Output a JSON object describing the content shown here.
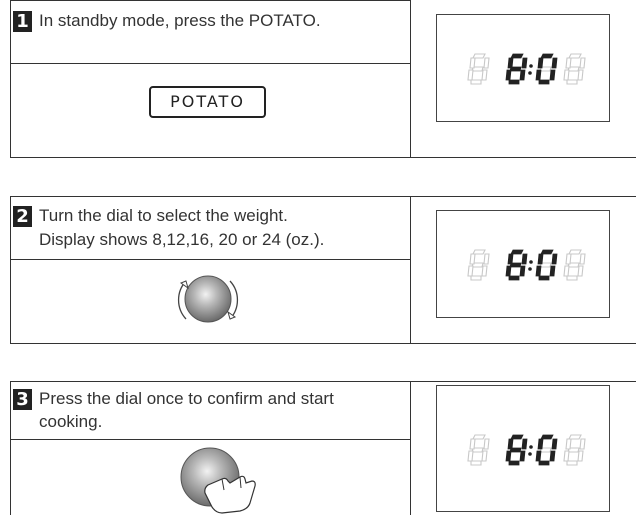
{
  "steps": [
    {
      "number": "1",
      "instruction": "In standby mode, press the POTATO.",
      "button_label": "POTATO"
    },
    {
      "number": "2",
      "instruction_line1": "Turn the dial to select the  weight.",
      "instruction_line2": "Display shows 8,12,16, 20 or 24 (oz.)."
    },
    {
      "number": "3",
      "instruction_line1": "Press the dial once to confirm and start",
      "instruction_line2": "cooking."
    }
  ],
  "display": {
    "text": "8:0"
  },
  "colors": {
    "ink": "#222222",
    "dim_segment": "#c8c8c8",
    "knob": "#a9a9a9"
  },
  "icons": [
    "rotate-dial-icon",
    "press-dial-icon"
  ]
}
